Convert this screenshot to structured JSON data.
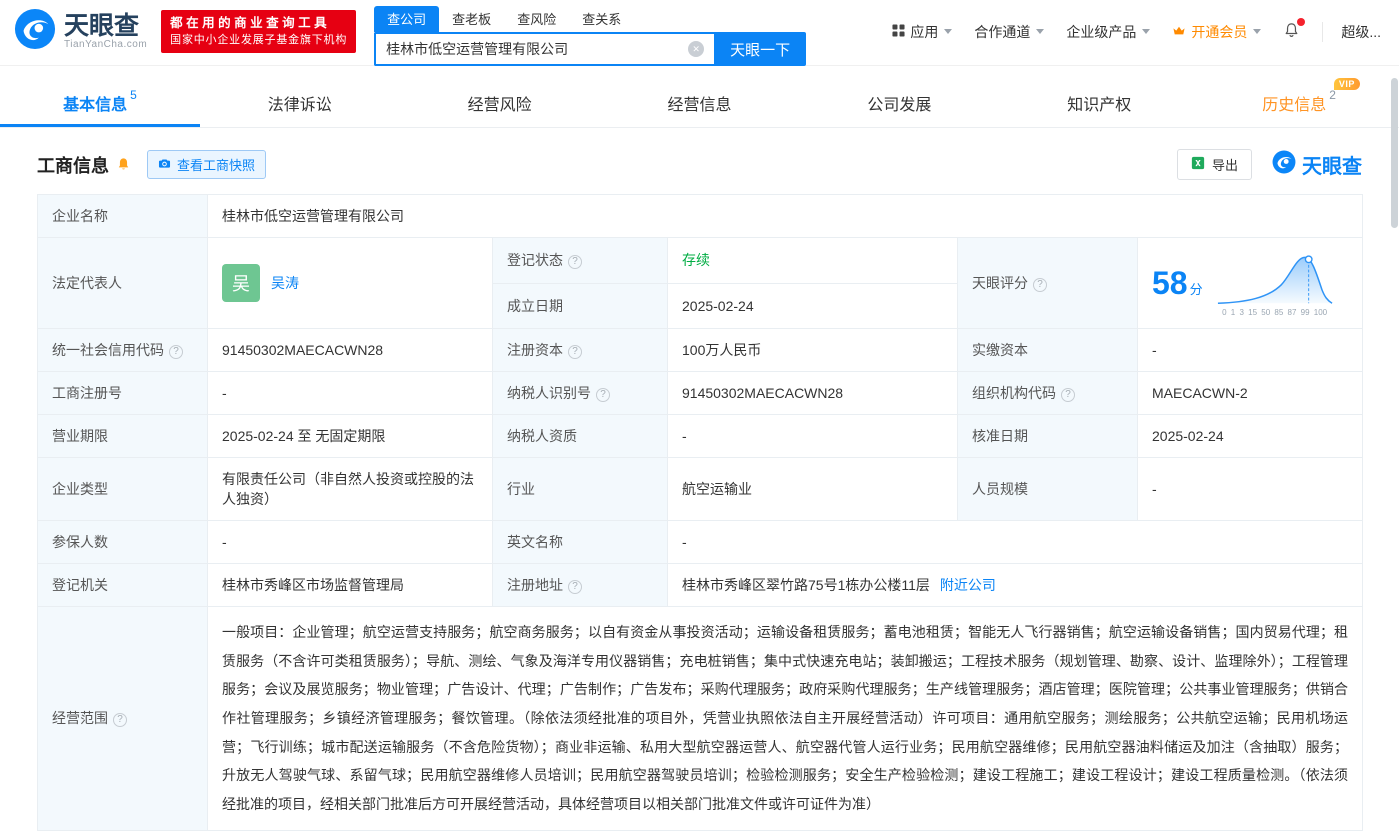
{
  "header": {
    "logo_text": "天眼查",
    "logo_subtext": "TianYanCha.com",
    "slogan_line1": "都在用的商业查询工具",
    "slogan_line2": "国家中小企业发展子基金旗下机构",
    "search_tabs": [
      {
        "label": "查公司"
      },
      {
        "label": "查老板"
      },
      {
        "label": "查风险"
      },
      {
        "label": "查关系"
      }
    ],
    "search_value": "桂林市低空运营管理有限公司",
    "search_button": "天眼一下",
    "nav": {
      "apps": "应用",
      "cooperation": "合作通道",
      "enterprise": "企业级产品",
      "vip": "开通会员",
      "user": "超级..."
    }
  },
  "tabs": [
    {
      "label": "基本信息",
      "badge": "5"
    },
    {
      "label": "法律诉讼",
      "badge": ""
    },
    {
      "label": "经营风险",
      "badge": ""
    },
    {
      "label": "经营信息",
      "badge": ""
    },
    {
      "label": "公司发展",
      "badge": ""
    },
    {
      "label": "知识产权",
      "badge": ""
    },
    {
      "label": "历史信息",
      "badge": "2",
      "tag": "VIP"
    }
  ],
  "section": {
    "title": "工商信息",
    "snapshot_button": "查看工商快照",
    "export_button": "导出",
    "brand": "天眼查"
  },
  "info": {
    "labels": {
      "company_name": "企业名称",
      "legal_rep": "法定代表人",
      "reg_status": "登记状态",
      "establish_date": "成立日期",
      "score": "天眼评分",
      "credit_code": "统一社会信用代码",
      "reg_capital": "注册资本",
      "paid_capital": "实缴资本",
      "reg_number": "工商注册号",
      "taxpayer_id": "纳税人识别号",
      "org_code": "组织机构代码",
      "business_term": "营业期限",
      "taxpayer_quality": "纳税人资质",
      "approval_date": "核准日期",
      "company_type": "企业类型",
      "industry": "行业",
      "staff_size": "人员规模",
      "insured_count": "参保人数",
      "english_name": "英文名称",
      "reg_authority": "登记机关",
      "reg_address": "注册地址",
      "business_scope": "经营范围"
    },
    "values": {
      "company_name": "桂林市低空运营管理有限公司",
      "legal_rep_avatar": "吴",
      "legal_rep": "吴涛",
      "reg_status": "存续",
      "establish_date": "2025-02-24",
      "score": "58",
      "score_unit": "分",
      "credit_code": "91450302MAECACWN28",
      "reg_capital": "100万人民币",
      "paid_capital": "-",
      "reg_number": "-",
      "taxpayer_id": "91450302MAECACWN28",
      "org_code": "MAECACWN-2",
      "business_term": "2025-02-24 至 无固定期限",
      "taxpayer_quality": "-",
      "approval_date": "2025-02-24",
      "company_type": "有限责任公司（非自然人投资或控股的法人独资）",
      "industry": "航空运输业",
      "staff_size": "-",
      "insured_count": "-",
      "english_name": "-",
      "reg_authority": "桂林市秀峰区市场监督管理局",
      "reg_address": "桂林市秀峰区翠竹路75号1栋办公楼11层",
      "nearby_link": "附近公司",
      "business_scope": "一般项目：企业管理；航空运营支持服务；航空商务服务；以自有资金从事投资活动；运输设备租赁服务；蓄电池租赁；智能无人飞行器销售；航空运输设备销售；国内贸易代理；租赁服务（不含许可类租赁服务）；导航、测绘、气象及海洋专用仪器销售；充电桩销售；集中式快速充电站；装卸搬运；工程技术服务（规划管理、勘察、设计、监理除外）；工程管理服务；会议及展览服务；物业管理；广告设计、代理；广告制作；广告发布；采购代理服务；政府采购代理服务；生产线管理服务；酒店管理；医院管理；公共事业管理服务；供销合作社管理服务；乡镇经济管理服务；餐饮管理。（除依法须经批准的项目外，凭营业执照依法自主开展经营活动）许可项目：通用航空服务；测绘服务；公共航空运输；民用机场运营；飞行训练；城市配送运输服务（不含危险货物）；商业非运输、私用大型航空器运营人、航空器代管人运行业务；民用航空器维修；民用航空器油料储运及加注（含抽取）服务；升放无人驾驶气球、系留气球；民用航空器维修人员培训；民用航空器驾驶员培训；检验检测服务；安全生产检验检测；建设工程施工；建设工程设计；建设工程质量检测。（依法须经批准的项目，经相关部门批准后方可开展经营活动，具体经营项目以相关部门批准文件或许可证件为准）"
    },
    "score_axis": "0 1 3 15 50 85 87 99 100"
  },
  "colors": {
    "brand_blue": "#0b84f5",
    "vip_orange": "#ff8a00",
    "status_green": "#00ad43",
    "badge_red": "#e60012"
  }
}
